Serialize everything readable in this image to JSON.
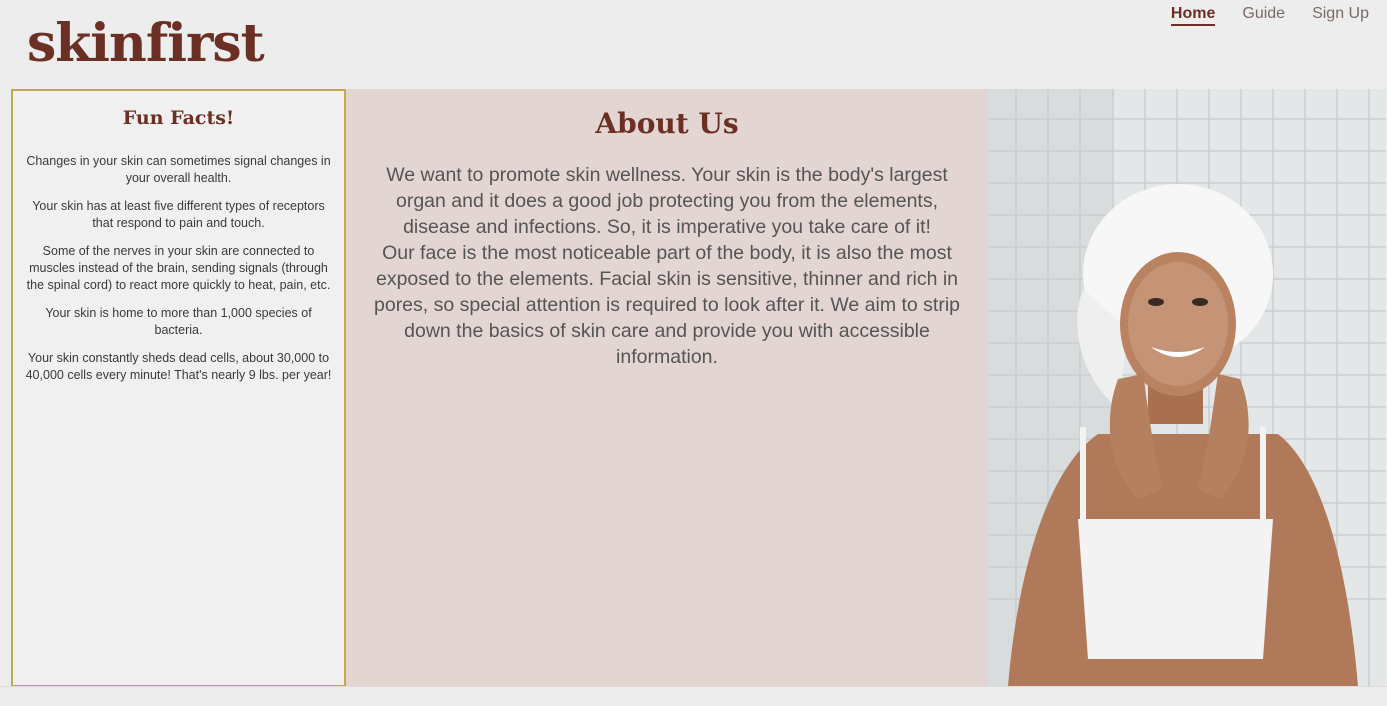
{
  "brand": {
    "logo": "skinfirst"
  },
  "nav": [
    {
      "label": "Home",
      "active": true
    },
    {
      "label": "Guide",
      "active": false
    },
    {
      "label": "Sign Up",
      "active": false
    }
  ],
  "fun_facts": {
    "title": "Fun Facts!",
    "items": [
      "Changes in your skin can sometimes signal changes in your overall health.",
      "Your skin has at least five different types of receptors that respond to pain and touch.",
      "Some of the nerves in your skin are connected to muscles instead of the brain, sending signals (through the spinal cord) to react more quickly to heat, pain, etc.",
      "Your skin is home to more than 1,000 species of bacteria.",
      "Your skin constantly sheds dead cells, about 30,000 to 40,000 cells every minute! That's nearly 9 lbs. per year!"
    ]
  },
  "about": {
    "title": "About Us",
    "paragraph_1": "We want to promote skin wellness. Your skin is the body's largest organ and it does a good job protecting you from the elements, disease and infections. So, it is imperative you take care of it!",
    "paragraph_2": "Our face is the most noticeable part of the body, it is also the most exposed to the elements. Facial skin is sensitive, thinner and rich in pores, so special attention is required to look after it. We aim to strip down the basics of skin care and provide you with accessible information."
  },
  "colors": {
    "brand": "#6b2f23",
    "panel_bg": "#e3d5d1",
    "border_gold": "#c4a84e"
  }
}
